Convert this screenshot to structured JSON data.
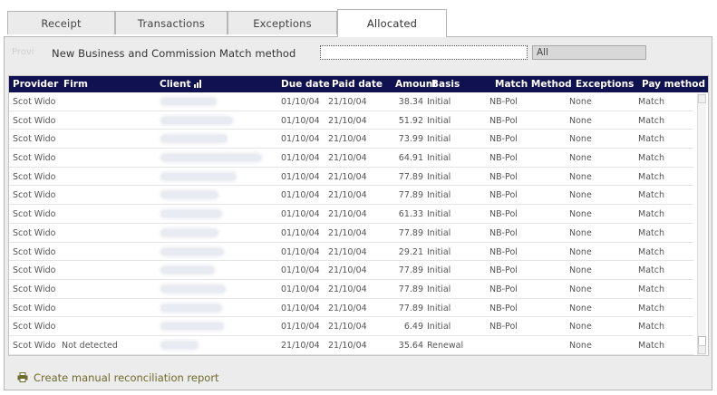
{
  "tabs": [
    {
      "label": "Receipt",
      "active": false
    },
    {
      "label": "Transactions",
      "active": false
    },
    {
      "label": "Exceptions",
      "active": false
    },
    {
      "label": "Allocated",
      "active": true
    }
  ],
  "match": {
    "ghost_label": "Provi",
    "label": "New Business and Commission Match method",
    "input_value": "",
    "select_value": "All"
  },
  "table": {
    "columns": {
      "provider": "Provider",
      "firm": "Firm",
      "client": "Client",
      "due_date": "Due date",
      "paid_date": "Paid date",
      "amount": "Amount",
      "basis": "Basis",
      "match_method": "Match Method",
      "exceptions": "Exceptions",
      "pay_method": "Pay method"
    },
    "rows": [
      {
        "provider": "Scot Wido",
        "firm": "",
        "due": "01/10/04",
        "paid": "21/10/04",
        "amount": "38.34",
        "basis": "Initial",
        "match": "NB-Pol",
        "exceptions": "None",
        "pay": "Match"
      },
      {
        "provider": "Scot Wido",
        "firm": "",
        "due": "01/10/04",
        "paid": "21/10/04",
        "amount": "51.92",
        "basis": "Initial",
        "match": "NB-Pol",
        "exceptions": "None",
        "pay": "Match"
      },
      {
        "provider": "Scot Wido",
        "firm": "",
        "due": "01/10/04",
        "paid": "21/10/04",
        "amount": "73.99",
        "basis": "Initial",
        "match": "NB-Pol",
        "exceptions": "None",
        "pay": "Match"
      },
      {
        "provider": "Scot Wido",
        "firm": "",
        "due": "01/10/04",
        "paid": "21/10/04",
        "amount": "64.91",
        "basis": "Initial",
        "match": "NB-Pol",
        "exceptions": "None",
        "pay": "Match"
      },
      {
        "provider": "Scot Wido",
        "firm": "",
        "due": "01/10/04",
        "paid": "21/10/04",
        "amount": "77.89",
        "basis": "Initial",
        "match": "NB-Pol",
        "exceptions": "None",
        "pay": "Match"
      },
      {
        "provider": "Scot Wido",
        "firm": "",
        "due": "01/10/04",
        "paid": "21/10/04",
        "amount": "77.89",
        "basis": "Initial",
        "match": "NB-Pol",
        "exceptions": "None",
        "pay": "Match"
      },
      {
        "provider": "Scot Wido",
        "firm": "",
        "due": "01/10/04",
        "paid": "21/10/04",
        "amount": "61.33",
        "basis": "Initial",
        "match": "NB-Pol",
        "exceptions": "None",
        "pay": "Match"
      },
      {
        "provider": "Scot Wido",
        "firm": "",
        "due": "01/10/04",
        "paid": "21/10/04",
        "amount": "77.89",
        "basis": "Initial",
        "match": "NB-Pol",
        "exceptions": "None",
        "pay": "Match"
      },
      {
        "provider": "Scot Wido",
        "firm": "",
        "due": "01/10/04",
        "paid": "21/10/04",
        "amount": "29.21",
        "basis": "Initial",
        "match": "NB-Pol",
        "exceptions": "None",
        "pay": "Match"
      },
      {
        "provider": "Scot Wido",
        "firm": "",
        "due": "01/10/04",
        "paid": "21/10/04",
        "amount": "77.89",
        "basis": "Initial",
        "match": "NB-Pol",
        "exceptions": "None",
        "pay": "Match"
      },
      {
        "provider": "Scot Wido",
        "firm": "",
        "due": "01/10/04",
        "paid": "21/10/04",
        "amount": "77.89",
        "basis": "Initial",
        "match": "NB-Pol",
        "exceptions": "None",
        "pay": "Match"
      },
      {
        "provider": "Scot Wido",
        "firm": "",
        "due": "01/10/04",
        "paid": "21/10/04",
        "amount": "77.89",
        "basis": "Initial",
        "match": "NB-Pol",
        "exceptions": "None",
        "pay": "Match"
      },
      {
        "provider": "Scot Wido",
        "firm": "",
        "due": "01/10/04",
        "paid": "21/10/04",
        "amount": "6.49",
        "basis": "Initial",
        "match": "NB-Pol",
        "exceptions": "None",
        "pay": "Match"
      },
      {
        "provider": "Scot Wido",
        "firm": "Not detected",
        "due": "21/10/04",
        "paid": "21/10/04",
        "amount": "35.64",
        "basis": "Renewal",
        "match": "",
        "exceptions": "None",
        "pay": "Match"
      }
    ]
  },
  "footer": {
    "report_link": "Create manual reconciliation report"
  },
  "icons": {
    "sort": "bar-chart-sort-icon",
    "printer": "printer-icon"
  },
  "colors": {
    "header_bg": "#0f1150",
    "link": "#6e6a2b",
    "panel_bg": "#ececec"
  }
}
